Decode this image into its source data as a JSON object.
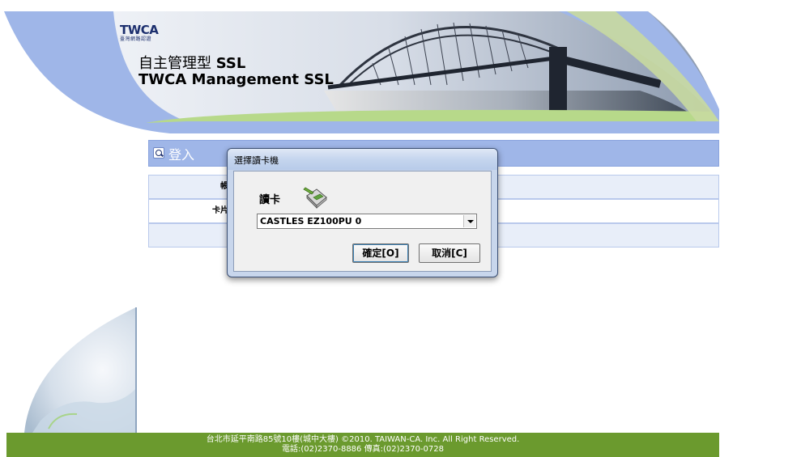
{
  "header": {
    "logo_text": "TWCA",
    "logo_subtitle": "臺灣網路認證",
    "title_zh_prefix": "自主管理型",
    "title_zh_suffix": "SSL",
    "title_en": "TWCA Management SSL"
  },
  "login": {
    "section_title": "登入",
    "row1_label": "帳",
    "row2_label": "卡片",
    "row3_label": ""
  },
  "dialog": {
    "title": "選擇讀卡機",
    "read_card_label": "讀卡",
    "reader_selected": "CASTLES EZ100PU 0",
    "ok_label": "確定[O]",
    "cancel_label": "取消[C]"
  },
  "footer": {
    "line1": "台北市延平南路85號10樓(城中大樓) ©2010. TAIWAN-CA. Inc. All Right Reserved.",
    "line2": "電話:(02)2370-8886 傳真:(02)2370-0728"
  },
  "colors": {
    "banner_blue": "#9fb6e8",
    "banner_green": "#b7d98a",
    "footer_green": "#6b9a2e",
    "dialog_frame": "#c8d6ec"
  },
  "icons": [
    "search-icon",
    "card-reader-icon",
    "chevron-down-icon"
  ]
}
